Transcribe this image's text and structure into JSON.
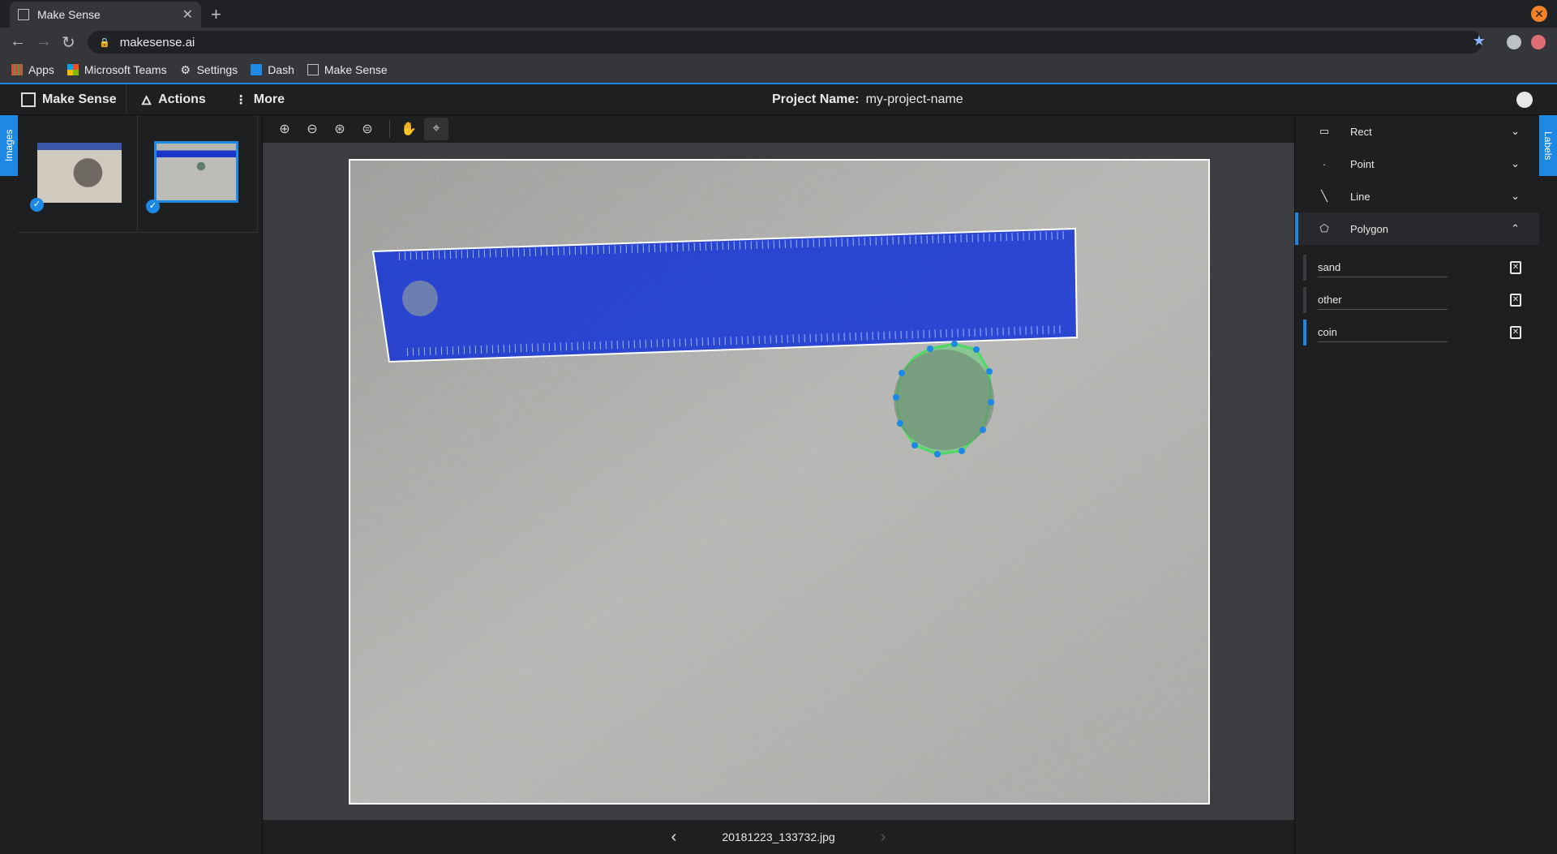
{
  "browser": {
    "tab_title": "Make Sense",
    "url": "makesense.ai",
    "bookmarks": [
      {
        "label": "Apps",
        "icon": "apps-grid-icon"
      },
      {
        "label": "Microsoft Teams",
        "icon": "microsoft-icon"
      },
      {
        "label": "Settings",
        "icon": "gear-icon"
      },
      {
        "label": "Dash",
        "icon": "chart-icon"
      },
      {
        "label": "Make Sense",
        "icon": "make-sense-icon"
      }
    ]
  },
  "app": {
    "brand": "Make Sense",
    "menu": {
      "actions": "Actions",
      "more": "More"
    },
    "project_label": "Project Name:",
    "project_name": "my-project-name",
    "left_tab": "Images",
    "right_tab": "Labels",
    "file_name": "20181223_133732.jpg"
  },
  "label_types": [
    {
      "name": "Rect",
      "icon": "rect-icon",
      "expanded": false
    },
    {
      "name": "Point",
      "icon": "point-icon",
      "expanded": false
    },
    {
      "name": "Line",
      "icon": "line-icon",
      "expanded": false
    },
    {
      "name": "Polygon",
      "icon": "polygon-icon",
      "expanded": true
    }
  ],
  "labels": [
    {
      "name": "sand",
      "selected": false
    },
    {
      "name": "other",
      "selected": false
    },
    {
      "name": "coin",
      "selected": true
    }
  ],
  "colors": {
    "accent": "#1e88e5",
    "polygon_line": "#4cd964"
  }
}
